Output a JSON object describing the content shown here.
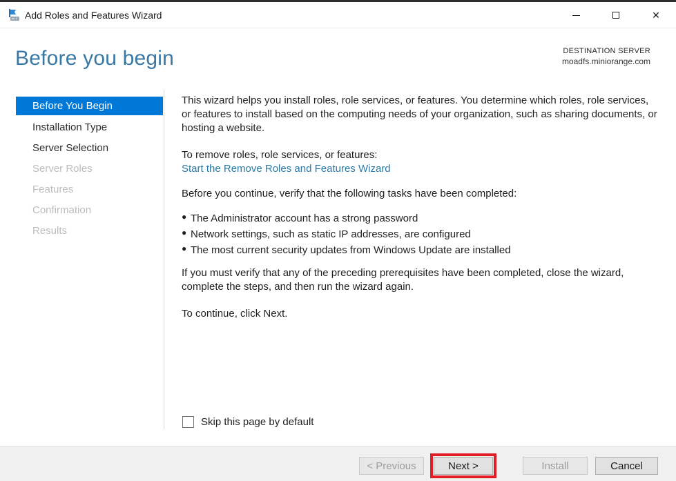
{
  "window": {
    "title": "Add Roles and Features Wizard"
  },
  "header": {
    "title": "Before you begin",
    "destination_label": "DESTINATION SERVER",
    "destination_server": "moadfs.miniorange.com"
  },
  "sidebar": {
    "items": [
      {
        "label": "Before You Begin",
        "state": "selected"
      },
      {
        "label": "Installation Type",
        "state": "enabled"
      },
      {
        "label": "Server Selection",
        "state": "enabled"
      },
      {
        "label": "Server Roles",
        "state": "disabled"
      },
      {
        "label": "Features",
        "state": "disabled"
      },
      {
        "label": "Confirmation",
        "state": "disabled"
      },
      {
        "label": "Results",
        "state": "disabled"
      }
    ]
  },
  "content": {
    "intro": "This wizard helps you install roles, role services, or features. You determine which roles, role services, or features to install based on the computing needs of your organization, such as sharing documents, or hosting a website.",
    "remove_heading": "To remove roles, role services, or features:",
    "remove_link": "Start the Remove Roles and Features Wizard",
    "verify_heading": "Before you continue, verify that the following tasks have been completed:",
    "tasks": [
      "The Administrator account has a strong password",
      "Network settings, such as static IP addresses, are configured",
      "The most current security updates from Windows Update are installed"
    ],
    "note": "If you must verify that any of the preceding prerequisites have been completed, close the wizard, complete the steps, and then run the wizard again.",
    "continue_hint": "To continue, click Next.",
    "skip_checkbox_label": "Skip this page by default",
    "skip_checkbox_checked": false
  },
  "footer": {
    "buttons": [
      {
        "label": "< Previous",
        "state": "disabled",
        "highlighted": false
      },
      {
        "label": "Next >",
        "state": "enabled",
        "highlighted": true
      },
      {
        "label": "Install",
        "state": "disabled",
        "highlighted": false
      },
      {
        "label": "Cancel",
        "state": "enabled",
        "highlighted": false
      }
    ]
  },
  "colors": {
    "accent_blue": "#0078d7",
    "heading_blue": "#3978a4",
    "link_blue": "#2a7ba6",
    "highlight_red": "#e11c24",
    "disabled_text": "#bcbcbc",
    "footer_bg": "#f0f0f0"
  }
}
